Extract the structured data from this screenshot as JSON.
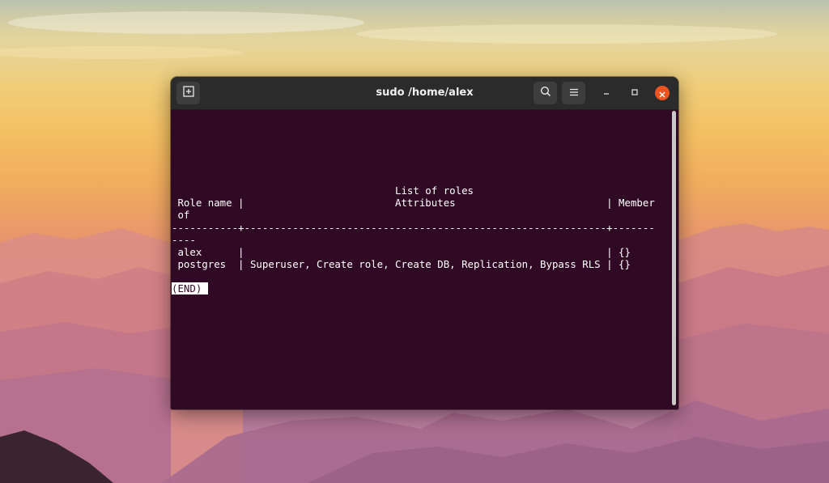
{
  "window": {
    "title": "sudo /home/alex"
  },
  "icons": {
    "new_tab": "new-tab-icon",
    "search": "search-icon",
    "menu": "hamburger-menu-icon",
    "minimize": "minimize-icon",
    "maximize": "maximize-icon",
    "close": "close-icon"
  },
  "colors": {
    "terminal_bg": "#300a24",
    "titlebar_bg": "#2b2b2b",
    "close_accent": "#e95420",
    "text": "#ffffff"
  },
  "terminal": {
    "lines": [
      "                                     List of roles",
      " Role name |                         Attributes                         | Member",
      " of",
      "-----------+------------------------------------------------------------+-------",
      "----",
      " alex      |                                                            | {}",
      " postgres  | Superuser, Create role, Create DB, Replication, Bypass RLS | {}"
    ],
    "prompt": "(END) "
  }
}
